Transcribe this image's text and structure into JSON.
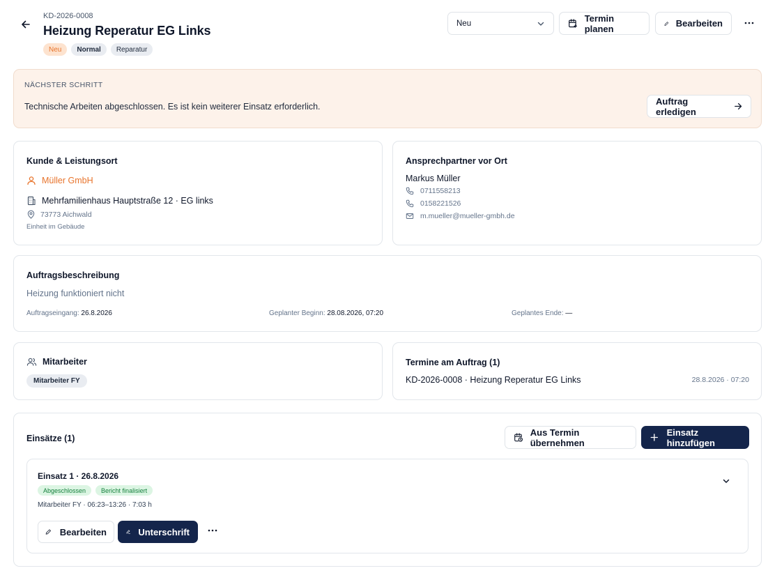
{
  "header": {
    "order_number": "KD-2026-0008",
    "title": "Heizung Reperatur EG Links",
    "tags": [
      "Neu",
      "Normal",
      "Reparatur"
    ],
    "status_value": "Neu",
    "schedule_label": "Termin planen",
    "edit_label": "Bearbeiten"
  },
  "next_step": {
    "label": "NÄCHSTER SCHRITT",
    "text": "Technische Arbeiten abgeschlossen. Es ist kein weiterer Einsatz erforderlich.",
    "action_label": "Auftrag erledigen"
  },
  "customer": {
    "title": "Kunde & Leistungsort",
    "name": "Müller GmbH",
    "building": "Mehrfamilienhaus Hauptstraße 12 · EG links",
    "address": "73773 Aichwald",
    "unit_note": "Einheit im Gebäude"
  },
  "contact": {
    "title": "Ansprechpartner vor Ort",
    "name": "Markus Müller",
    "phone1": "0711558213",
    "phone2": "0158221526",
    "email": "m.mueller@mueller-gmbh.de"
  },
  "description": {
    "title": "Auftragsbeschreibung",
    "text": "Heizung funktioniert nicht",
    "received_label": "Auftragseingang:",
    "received_value": "26.8.2026",
    "start_label": "Geplanter Beginn:",
    "start_value": "28.08.2026, 07:20",
    "end_label": "Geplantes Ende:",
    "end_value": "—"
  },
  "staff": {
    "title": "Mitarbeiter",
    "chip": "Mitarbeiter FY"
  },
  "appointments": {
    "title": "Termine am Auftrag (1)",
    "item_label": "KD-2026-0008 · Heizung Reperatur EG Links",
    "item_date": "28.8.2026 · 07:20"
  },
  "operations": {
    "title": "Einsätze (1)",
    "take_over_label": "Aus Termin übernehmen",
    "add_label": "Einsatz hinzufügen",
    "item": {
      "title": "Einsatz 1 · 26.8.2026",
      "status1": "Abgeschlossen",
      "status2": "Bericht finalisiert",
      "meta": "Mitarbeiter FY · 06:23–13:26 · 7:03 h",
      "edit_label": "Bearbeiten",
      "sign_label": "Unterschrift"
    }
  },
  "colors": {
    "accent": "#e8742c",
    "primary_dark": "#14254b",
    "banner_bg": "#fdf2ea",
    "success_bg": "#dcf5e3",
    "success_text": "#15803d"
  }
}
